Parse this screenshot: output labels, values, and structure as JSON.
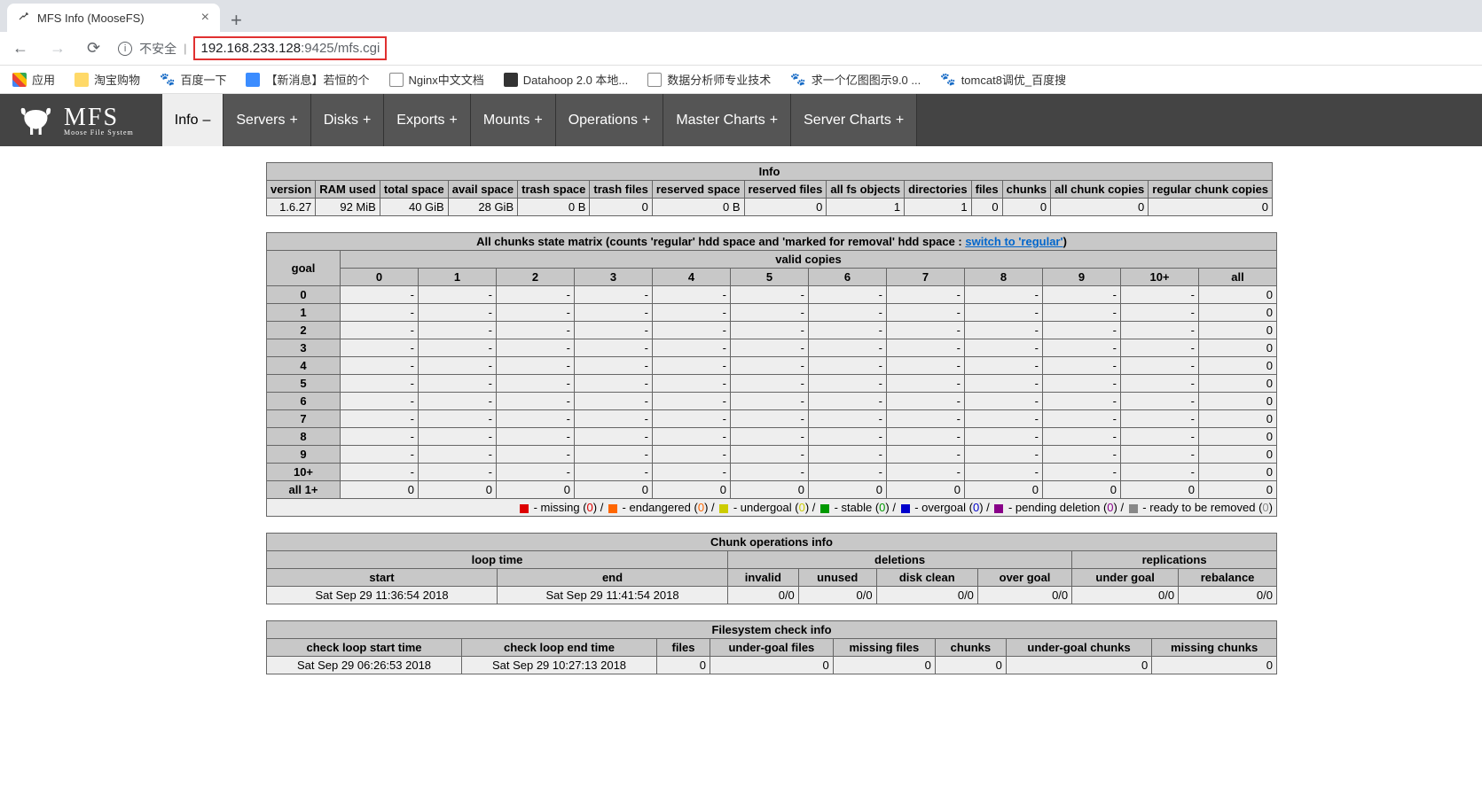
{
  "browser": {
    "tab_title": "MFS Info (MooseFS)",
    "not_secure": "不安全",
    "url": {
      "ip": "192.168.233.128",
      "port": ":9425",
      "path": "/mfs.cgi"
    }
  },
  "bookmarks": [
    {
      "label": "应用",
      "icon": "apps"
    },
    {
      "label": "淘宝购物",
      "icon": "folder"
    },
    {
      "label": "百度一下",
      "icon": "paw"
    },
    {
      "label": "【新消息】若恒的个",
      "icon": "blue"
    },
    {
      "label": "Nginx中文文档",
      "icon": "file"
    },
    {
      "label": "Datahoop 2.0 本地...",
      "icon": "dh"
    },
    {
      "label": "数据分析师专业技术",
      "icon": "file"
    },
    {
      "label": "求一个亿图图示9.0 ...",
      "icon": "paw"
    },
    {
      "label": "tomcat8调优_百度搜",
      "icon": "paw"
    }
  ],
  "mfs_tabs": [
    {
      "label": "Info",
      "suffix": "–",
      "active": true
    },
    {
      "label": "Servers",
      "suffix": "+"
    },
    {
      "label": "Disks",
      "suffix": "+"
    },
    {
      "label": "Exports",
      "suffix": "+"
    },
    {
      "label": "Mounts",
      "suffix": "+"
    },
    {
      "label": "Operations",
      "suffix": "+"
    },
    {
      "label": "Master Charts",
      "suffix": "+"
    },
    {
      "label": "Server Charts",
      "suffix": "+"
    }
  ],
  "info": {
    "title": "Info",
    "headers": [
      "version",
      "RAM used",
      "total space",
      "avail space",
      "trash space",
      "trash files",
      "reserved space",
      "reserved files",
      "all fs objects",
      "directories",
      "files",
      "chunks",
      "all chunk copies",
      "regular chunk copies"
    ],
    "values": [
      "1.6.27",
      "92 MiB",
      "40 GiB",
      "28 GiB",
      "0 B",
      "0",
      "0 B",
      "0",
      "1",
      "1",
      "0",
      "0",
      "0",
      "0"
    ]
  },
  "matrix": {
    "title_prefix": "All chunks state matrix (counts 'regular' hdd space and 'marked for removal' hdd space : ",
    "title_link": "switch to 'regular'",
    "title_suffix": ")",
    "goal_label": "goal",
    "valid_label": "valid copies",
    "cols": [
      "0",
      "1",
      "2",
      "3",
      "4",
      "5",
      "6",
      "7",
      "8",
      "9",
      "10+",
      "all"
    ],
    "rows": [
      "0",
      "1",
      "2",
      "3",
      "4",
      "5",
      "6",
      "7",
      "8",
      "9",
      "10+"
    ],
    "last_row_label": "all 1+",
    "last_row": [
      "0",
      "0",
      "0",
      "0",
      "0",
      "0",
      "0",
      "0",
      "0",
      "0",
      "0",
      "0"
    ],
    "legend": [
      {
        "color": "#d00",
        "label": "missing",
        "count": "0"
      },
      {
        "color": "#f60",
        "label": "endangered",
        "count": "0"
      },
      {
        "color": "#cc0",
        "label": "undergoal",
        "count": "0"
      },
      {
        "color": "#090",
        "label": "stable",
        "count": "0"
      },
      {
        "color": "#00c",
        "label": "overgoal",
        "count": "0"
      },
      {
        "color": "#808",
        "label": "pending deletion",
        "count": "0"
      },
      {
        "color": "#888",
        "label": "ready to be removed",
        "count": "0"
      }
    ]
  },
  "chunk_ops": {
    "title": "Chunk operations info",
    "loop_label": "loop time",
    "del_label": "deletions",
    "rep_label": "replications",
    "start_label": "start",
    "end_label": "end",
    "del_headers": [
      "invalid",
      "unused",
      "disk clean",
      "over goal"
    ],
    "rep_headers": [
      "under goal",
      "rebalance"
    ],
    "start": "Sat Sep 29 11:36:54 2018",
    "end": "Sat Sep 29 11:41:54 2018",
    "del_values": [
      "0/0",
      "0/0",
      "0/0",
      "0/0"
    ],
    "rep_values": [
      "0/0",
      "0/0"
    ]
  },
  "fs_check": {
    "title": "Filesystem check info",
    "headers": [
      "check loop start time",
      "check loop end time",
      "files",
      "under-goal files",
      "missing files",
      "chunks",
      "under-goal chunks",
      "missing chunks"
    ],
    "values": [
      "Sat Sep 29 06:26:53 2018",
      "Sat Sep 29 10:27:13 2018",
      "0",
      "0",
      "0",
      "0",
      "0",
      "0"
    ]
  }
}
